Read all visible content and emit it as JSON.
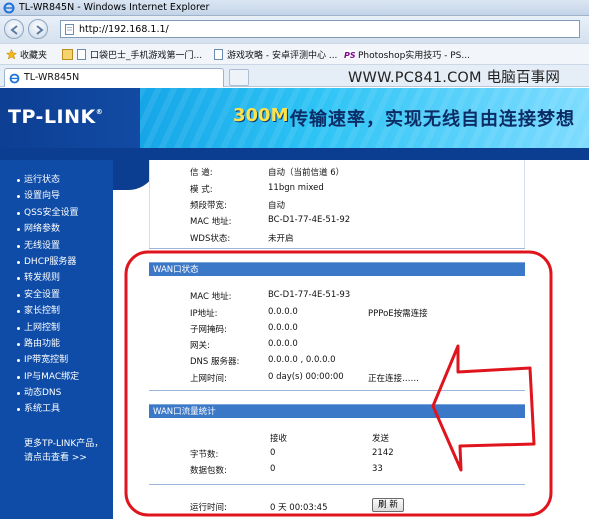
{
  "browser": {
    "window_title": "TL-WR845N - Windows Internet Explorer",
    "address_url": "http://192.168.1.1/",
    "favorites_label": "收藏夹",
    "favorites": [
      "口袋巴士_手机游戏第一门...",
      "游戏攻略 - 安卓评测中心 ...",
      "Photoshop实用技巧 - PS..."
    ],
    "tab_title": "TL-WR845N",
    "watermark": "WWW.PC841.COM 电脑百事网"
  },
  "router": {
    "logo": "TP-LINK",
    "slogan_num": "300M",
    "slogan": "传输速率，实现无线自由连接梦想"
  },
  "sidebar": {
    "items": [
      "运行状态",
      "设置向导",
      "QSS安全设置",
      "网络参数",
      "无线设置",
      "DHCP服务器",
      "转发规则",
      "安全设置",
      "家长控制",
      "上网控制",
      "路由功能",
      "IP带宽控制",
      "IP与MAC绑定",
      "动态DNS",
      "系统工具"
    ],
    "more_line1": "更多TP-LINK产品，",
    "more_line2": "请点击查看 >>"
  },
  "wireless": {
    "channel_label": "信  道:",
    "channel_value": "自动（当前信道 6）",
    "mode_label": "模  式:",
    "mode_value": "11bgn mixed",
    "bandwidth_label": "频段带宽:",
    "bandwidth_value": "自动",
    "mac_label": "MAC 地址:",
    "mac_value": "BC-D1-77-4E-51-92",
    "wds_label": "WDS状态:",
    "wds_value": "未开启"
  },
  "wan": {
    "header": "WAN口状态",
    "mac_label": "MAC 地址:",
    "mac_value": "BC-D1-77-4E-51-93",
    "ip_label": "IP地址:",
    "ip_value": "0.0.0.0",
    "ip_note": "PPPoE按需连接",
    "mask_label": "子网掩码:",
    "mask_value": "0.0.0.0",
    "gateway_label": "网关:",
    "gateway_value": "0.0.0.0",
    "dns_label": "DNS 服务器:",
    "dns_value": "0.0.0.0 , 0.0.0.0",
    "uptime_label": "上网时间:",
    "uptime_value": "0 day(s) 00:00:00",
    "uptime_status": "正在连接……"
  },
  "traffic": {
    "header": "WAN口流量统计",
    "col_receive": "接收",
    "col_send": "发送",
    "bytes_label": "字节数:",
    "bytes_receive": "0",
    "bytes_send": "2142",
    "packets_label": "数据包数:",
    "packets_receive": "0",
    "packets_send": "33"
  },
  "runtime": {
    "label": "运行时间:",
    "value": "0 天 00:03:45",
    "refresh_button": "刷 新"
  },
  "colors": {
    "router_blue": "#0e4ca8",
    "section_header": "#3c78c8",
    "annotation_red": "#e0141c"
  }
}
